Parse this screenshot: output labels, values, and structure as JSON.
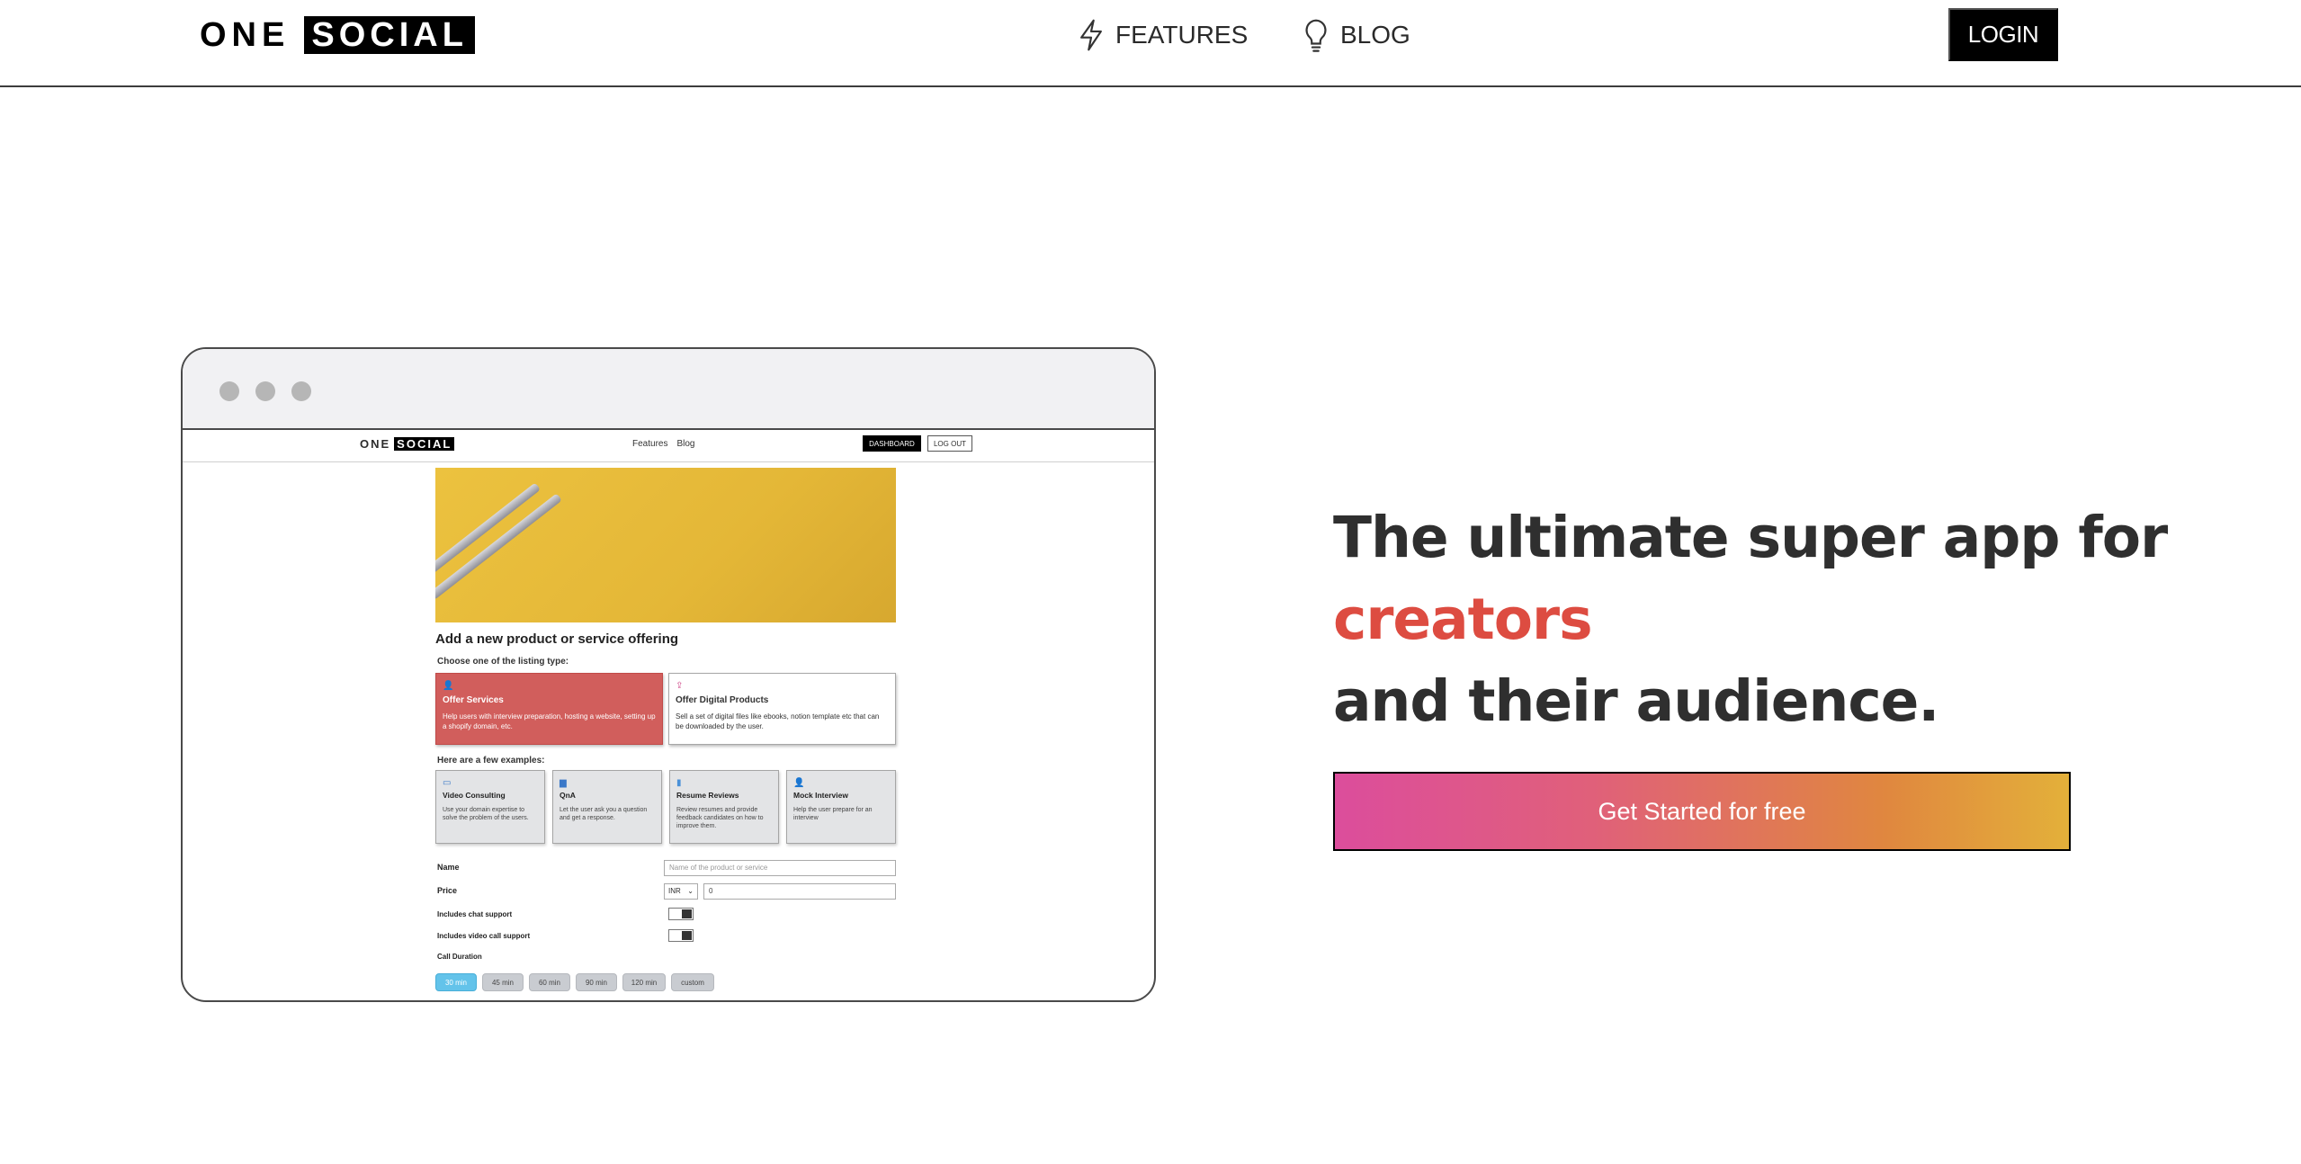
{
  "nav": {
    "logo_one": "ONE",
    "logo_social": "SOCIAL",
    "features_label": "FEATURES",
    "blog_label": "BLOG",
    "login_label": "LOGIN"
  },
  "mockup": {
    "logo_one": "ONE",
    "logo_social": "SOCIAL",
    "links": [
      "Features",
      "Blog"
    ],
    "dashboard_label": "DASHBOARD",
    "logout_label": "LOG OUT",
    "form_title": "Add a new product or service offering",
    "choose_label": "Choose one of the listing type:",
    "listing_types": [
      {
        "title": "Offer Services",
        "desc": "Help users with interview preparation, hosting a website, setting up a shopify domain, etc."
      },
      {
        "title": "Offer Digital Products",
        "desc": "Sell a set of digital files like ebooks, notion template etc that can be downloaded by the user."
      }
    ],
    "examples_label": "Here are a few examples:",
    "examples": [
      {
        "title": "Video Consulting",
        "desc": "Use your domain expertise to solve the problem of the users."
      },
      {
        "title": "QnA",
        "desc": "Let the user ask you a question and get a response."
      },
      {
        "title": "Resume Reviews",
        "desc": "Review resumes and provide feedback candidates on how to improve them."
      },
      {
        "title": "Mock Interview",
        "desc": "Help the user prepare for an interview"
      }
    ],
    "name_label": "Name",
    "name_placeholder": "Name of the product or service",
    "price_label": "Price",
    "currency": "INR",
    "price_value": "0",
    "chat_support_label": "Includes chat support",
    "video_support_label": "Includes video call support",
    "call_duration_label": "Call Duration",
    "durations": [
      "30 min",
      "45 min",
      "60 min",
      "90 min",
      "120 min",
      "custom"
    ],
    "selected_duration": "30 min"
  },
  "hero": {
    "line1": "The ultimate super app for",
    "accent": "creators",
    "line3": "and their audience.",
    "cta_label": "Get Started for free"
  }
}
